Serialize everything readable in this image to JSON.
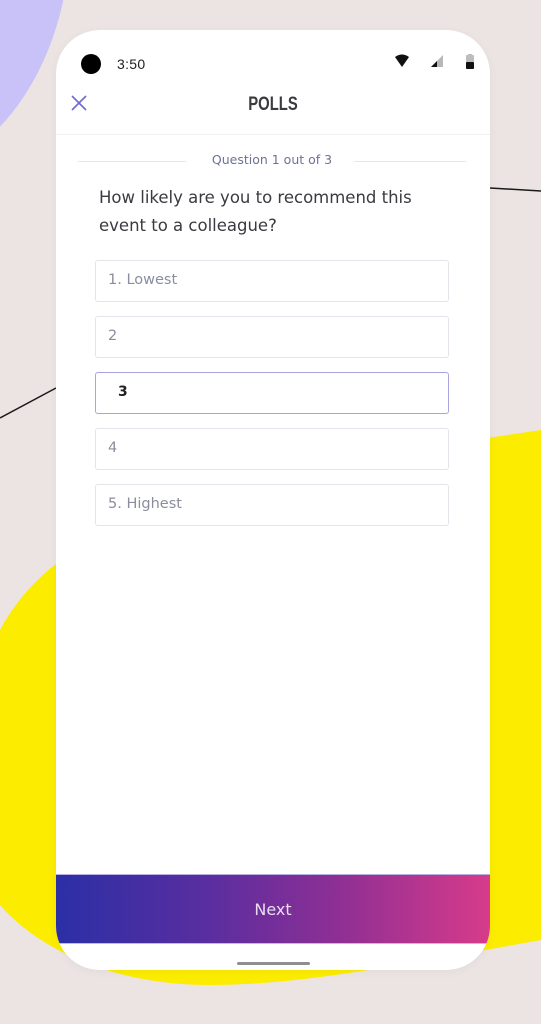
{
  "status_bar": {
    "time": "3:50",
    "icons": [
      "camera-cutout",
      "wifi-icon",
      "signal-icon",
      "battery-icon"
    ]
  },
  "header": {
    "title": "POLLS",
    "close_icon": "close-icon"
  },
  "poll": {
    "progress_text": "Question 1 out of 3",
    "current_question": 1,
    "total_questions": 3,
    "question": "How likely are you to recommend this event to a colleague?",
    "options": [
      {
        "label": "1. Lowest",
        "selected": false
      },
      {
        "label": "2",
        "selected": false
      },
      {
        "label": "3",
        "selected": true
      },
      {
        "label": "4",
        "selected": false
      },
      {
        "label": "5. Highest",
        "selected": false
      }
    ],
    "selected_value": "3"
  },
  "footer": {
    "next_label": "Next"
  },
  "colors": {
    "accent": "#7b76d6",
    "selected_border": "#a7a4df",
    "button_gradient_start": "#2b2fa5",
    "button_gradient_end": "#d83b8a",
    "background": "#ece4e2",
    "decor_yellow": "#fff000",
    "decor_purple": "#c9c2f8"
  }
}
